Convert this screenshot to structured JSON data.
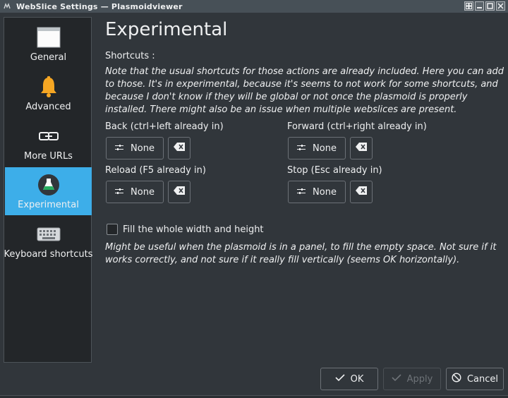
{
  "window": {
    "title": "WebSlice Settings — Plasmoidviewer"
  },
  "sidebar": {
    "items": [
      {
        "label": "General",
        "icon": "window-icon"
      },
      {
        "label": "Advanced",
        "icon": "bell-icon"
      },
      {
        "label": "More URLs",
        "icon": "link-icon"
      },
      {
        "label": "Experimental",
        "icon": "flask-icon",
        "active": true
      },
      {
        "label": "Keyboard shortcuts",
        "icon": "keyboard-icon"
      }
    ]
  },
  "page": {
    "title": "Experimental",
    "shortcuts_label": "Shortcuts :",
    "shortcuts_note": "Note that the usual shortcuts for those actions are already included. Here you can add to those. It's in experimental, because it's seems to not work for some shortcuts, and because I don't know if they will be global or not once the plasmoid is properly installed. There might also be an issue when multiple webslices are present.",
    "back_label": "Back (ctrl+left already in)",
    "forward_label": "Forward (ctrl+right already in)",
    "reload_label": "Reload (F5 already in)",
    "stop_label": "Stop (Esc already in)",
    "none_text": "None",
    "fill_label": "Fill the whole width and height",
    "fill_note": "Might be useful when the plasmoid is in a panel, to fill the empty space. Not sure if it works correctly, and not sure if it really fill vertically (seems OK horizontally)."
  },
  "buttons": {
    "ok": "OK",
    "apply": "Apply",
    "cancel": "Cancel"
  },
  "colors": {
    "accent": "#3daee9",
    "background": "#31363b",
    "sidebar": "#232629"
  }
}
